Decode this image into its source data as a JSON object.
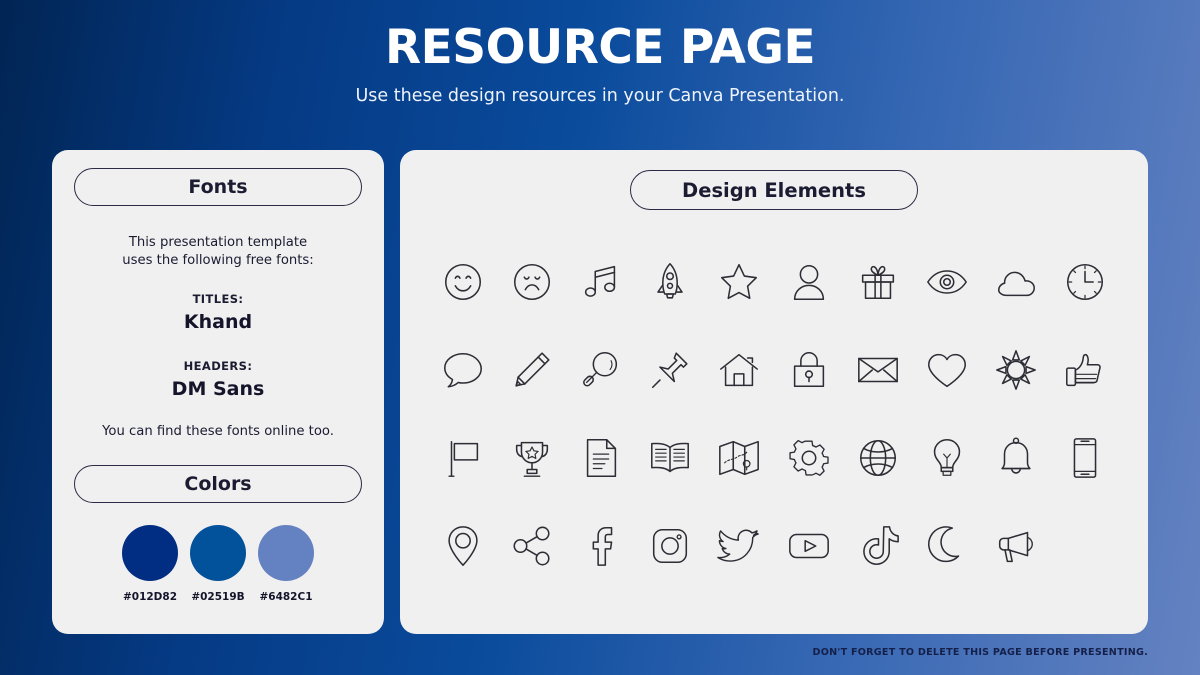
{
  "header": {
    "title": "RESOURCE PAGE",
    "subtitle": "Use these design resources in your Canva Presentation."
  },
  "fonts_panel": {
    "heading": "Fonts",
    "intro_line1": "This presentation template",
    "intro_line2": "uses the following free fonts:",
    "titles_label": "TITLES:",
    "titles_value": "Khand",
    "headers_label": "HEADERS:",
    "headers_value": "DM Sans",
    "outro": "You can find these fonts online too."
  },
  "colors_panel": {
    "heading": "Colors",
    "swatches": [
      {
        "hex": "#012D82",
        "label": "#012D82"
      },
      {
        "hex": "#02519B",
        "label": "#02519B"
      },
      {
        "hex": "#6482C1",
        "label": "#6482C1"
      }
    ]
  },
  "elements_panel": {
    "heading": "Design Elements",
    "icons": [
      "smiley-face-icon",
      "sad-face-icon",
      "music-note-icon",
      "rocket-icon",
      "star-icon",
      "person-icon",
      "gift-icon",
      "eye-icon",
      "cloud-icon",
      "clock-icon",
      "speech-bubble-icon",
      "pencil-icon",
      "magnifier-icon",
      "pushpin-icon",
      "house-icon",
      "lock-icon",
      "envelope-icon",
      "heart-icon",
      "sun-icon",
      "thumbs-up-icon",
      "flag-icon",
      "trophy-icon",
      "document-icon",
      "book-icon",
      "map-icon",
      "gear-icon",
      "globe-icon",
      "lightbulb-icon",
      "bell-icon",
      "smartphone-icon",
      "location-pin-icon",
      "share-icon",
      "facebook-icon",
      "instagram-icon",
      "twitter-icon",
      "youtube-icon",
      "tiktok-icon",
      "moon-icon",
      "megaphone-icon"
    ]
  },
  "footer": {
    "note": "DON'T FORGET TO DELETE THIS PAGE BEFORE PRESENTING."
  }
}
